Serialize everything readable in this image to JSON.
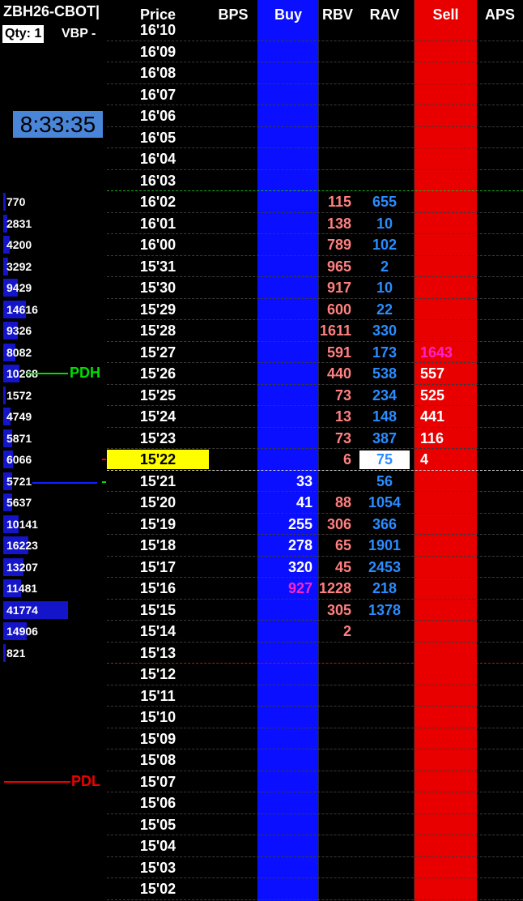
{
  "header": {
    "symbol": "ZBH26-CBOT",
    "qty_label": "Qty:",
    "qty_value": "1",
    "vbp_label": "VBP -",
    "columns": [
      "Price",
      "BPS",
      "Buy",
      "RBV",
      "RAV",
      "Sell",
      "APS"
    ]
  },
  "clock": "8:33:35",
  "colors": {
    "buy_column": "#0a10ff",
    "sell_column": "#e80000",
    "last_price_highlight": "#ffff00",
    "rbv_text": "#ff8080",
    "rav_text": "#2a8cff",
    "highlight_text": "#ff22cc",
    "pdh_line": "#00dd00",
    "pdl_line": "#ee0000"
  },
  "levels": {
    "pdh": "PDH",
    "pdl": "PDL"
  },
  "rows": [
    {
      "price": "16'10",
      "vol": "",
      "buy": "",
      "rbv": "",
      "rav": "",
      "sell": ""
    },
    {
      "price": "16'09",
      "vol": "",
      "buy": "",
      "rbv": "",
      "rav": "",
      "sell": ""
    },
    {
      "price": "16'08",
      "vol": "",
      "buy": "",
      "rbv": "",
      "rav": "",
      "sell": ""
    },
    {
      "price": "16'07",
      "vol": "",
      "buy": "",
      "rbv": "",
      "rav": "",
      "sell": ""
    },
    {
      "price": "16'06",
      "vol": "",
      "buy": "",
      "rbv": "",
      "rav": "",
      "sell": ""
    },
    {
      "price": "16'05",
      "vol": "",
      "buy": "",
      "rbv": "",
      "rav": "",
      "sell": ""
    },
    {
      "price": "16'04",
      "vol": "",
      "buy": "",
      "rbv": "",
      "rav": "",
      "sell": ""
    },
    {
      "price": "16'03",
      "vol": "",
      "buy": "",
      "rbv": "",
      "rav": "",
      "sell": ""
    },
    {
      "price": "16'02",
      "vol": "770",
      "buy": "",
      "rbv": "115",
      "rav": "655",
      "sell": ""
    },
    {
      "price": "16'01",
      "vol": "2831",
      "buy": "",
      "rbv": "138",
      "rav": "10",
      "sell": ""
    },
    {
      "price": "16'00",
      "vol": "4200",
      "buy": "",
      "rbv": "789",
      "rav": "102",
      "sell": ""
    },
    {
      "price": "15'31",
      "vol": "3292",
      "buy": "",
      "rbv": "965",
      "rav": "2",
      "sell": ""
    },
    {
      "price": "15'30",
      "vol": "9429",
      "buy": "",
      "rbv": "917",
      "rav": "10",
      "sell": ""
    },
    {
      "price": "15'29",
      "vol": "14616",
      "buy": "",
      "rbv": "600",
      "rav": "22",
      "sell": ""
    },
    {
      "price": "15'28",
      "vol": "9326",
      "buy": "",
      "rbv": "1611",
      "rav": "330",
      "sell": ""
    },
    {
      "price": "15'27",
      "vol": "8082",
      "buy": "",
      "rbv": "591",
      "rav": "173",
      "sell": "1643",
      "sell_highlight": true
    },
    {
      "price": "15'26",
      "vol": "10268",
      "buy": "",
      "rbv": "440",
      "rav": "538",
      "sell": "557",
      "pdh": true
    },
    {
      "price": "15'25",
      "vol": "1572",
      "buy": "",
      "rbv": "73",
      "rav": "234",
      "sell": "525"
    },
    {
      "price": "15'24",
      "vol": "4749",
      "buy": "",
      "rbv": "13",
      "rav": "148",
      "sell": "441"
    },
    {
      "price": "15'23",
      "vol": "5871",
      "buy": "",
      "rbv": "73",
      "rav": "387",
      "sell": "116"
    },
    {
      "price": "15'22",
      "vol": "6066",
      "buy": "",
      "rbv": "6",
      "rav": "75",
      "sell": "4",
      "last": true
    },
    {
      "price": "15'21",
      "vol": "5721",
      "buy": "33",
      "rbv": "",
      "rav": "56",
      "sell": ""
    },
    {
      "price": "15'20",
      "vol": "5637",
      "buy": "41",
      "rbv": "88",
      "rav": "1054",
      "sell": ""
    },
    {
      "price": "15'19",
      "vol": "10141",
      "buy": "255",
      "rbv": "306",
      "rav": "366",
      "sell": ""
    },
    {
      "price": "15'18",
      "vol": "16223",
      "buy": "278",
      "rbv": "65",
      "rav": "1901",
      "sell": ""
    },
    {
      "price": "15'17",
      "vol": "13207",
      "buy": "320",
      "rbv": "45",
      "rav": "2453",
      "sell": ""
    },
    {
      "price": "15'16",
      "vol": "11481",
      "buy": "927",
      "rbv": "1228",
      "rav": "218",
      "sell": "",
      "buy_highlight": true
    },
    {
      "price": "15'15",
      "vol": "41774",
      "buy": "",
      "rbv": "305",
      "rav": "1378",
      "sell": ""
    },
    {
      "price": "15'14",
      "vol": "14906",
      "buy": "",
      "rbv": "2",
      "rav": "",
      "sell": ""
    },
    {
      "price": "15'13",
      "vol": "821",
      "buy": "",
      "rbv": "",
      "rav": "",
      "sell": ""
    },
    {
      "price": "15'12",
      "vol": "",
      "buy": "",
      "rbv": "",
      "rav": "",
      "sell": ""
    },
    {
      "price": "15'11",
      "vol": "",
      "buy": "",
      "rbv": "",
      "rav": "",
      "sell": ""
    },
    {
      "price": "15'10",
      "vol": "",
      "buy": "",
      "rbv": "",
      "rav": "",
      "sell": ""
    },
    {
      "price": "15'09",
      "vol": "",
      "buy": "",
      "rbv": "",
      "rav": "",
      "sell": ""
    },
    {
      "price": "15'08",
      "vol": "",
      "buy": "",
      "rbv": "",
      "rav": "",
      "sell": ""
    },
    {
      "price": "15'07",
      "vol": "",
      "buy": "",
      "rbv": "",
      "rav": "",
      "sell": "",
      "pdl": true
    },
    {
      "price": "15'06",
      "vol": "",
      "buy": "",
      "rbv": "",
      "rav": "",
      "sell": ""
    },
    {
      "price": "15'05",
      "vol": "",
      "buy": "",
      "rbv": "",
      "rav": "",
      "sell": ""
    },
    {
      "price": "15'04",
      "vol": "",
      "buy": "",
      "rbv": "",
      "rav": "",
      "sell": ""
    },
    {
      "price": "15'03",
      "vol": "",
      "buy": "",
      "rbv": "",
      "rav": "",
      "sell": ""
    },
    {
      "price": "15'02",
      "vol": "",
      "buy": "",
      "rbv": "",
      "rav": "",
      "sell": ""
    }
  ]
}
